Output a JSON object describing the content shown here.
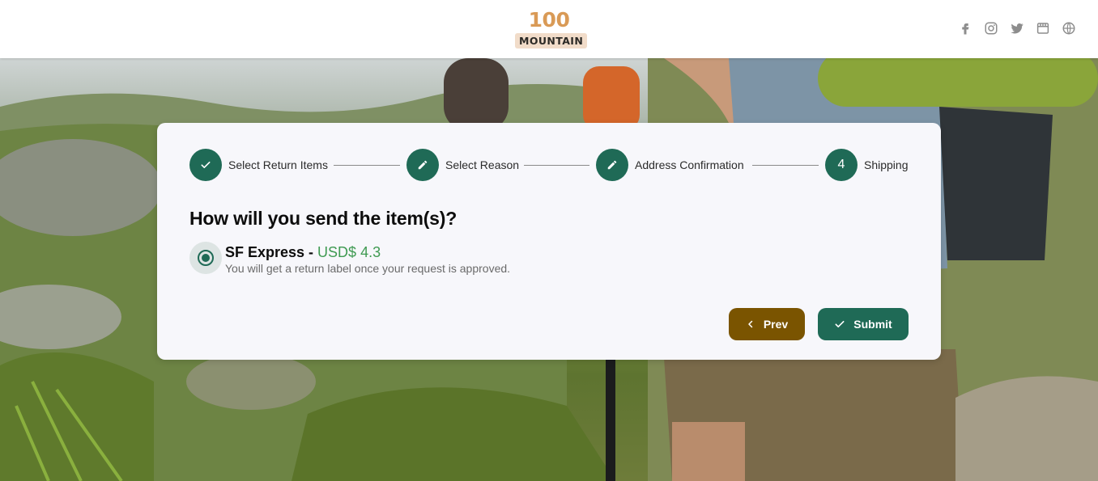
{
  "brand": {
    "number": "100",
    "word": "MOUNTAIN"
  },
  "header": {
    "socials": [
      "facebook-icon",
      "instagram-icon",
      "twitter-icon",
      "store-icon",
      "globe-icon"
    ]
  },
  "stepper": {
    "steps": [
      {
        "label": "Select Return Items",
        "state": "done",
        "icon": "check-icon"
      },
      {
        "label": "Select Reason",
        "state": "edit",
        "icon": "pencil-icon"
      },
      {
        "label": "Address Confirmation",
        "state": "edit",
        "icon": "pencil-icon"
      },
      {
        "label": "Shipping",
        "state": "current",
        "number": "4"
      }
    ]
  },
  "form": {
    "question": "How will you send the item(s)?",
    "option": {
      "carrier": "SF Express - ",
      "price": "USD$ 4.3",
      "description": "You will get a return label once your request is approved.",
      "selected": true
    }
  },
  "actions": {
    "prev_label": "Prev",
    "submit_label": "Submit"
  },
  "colors": {
    "primary": "#1f6a56",
    "prev": "#7a5400",
    "price": "#3f9a52",
    "logo": "#d99a56"
  }
}
